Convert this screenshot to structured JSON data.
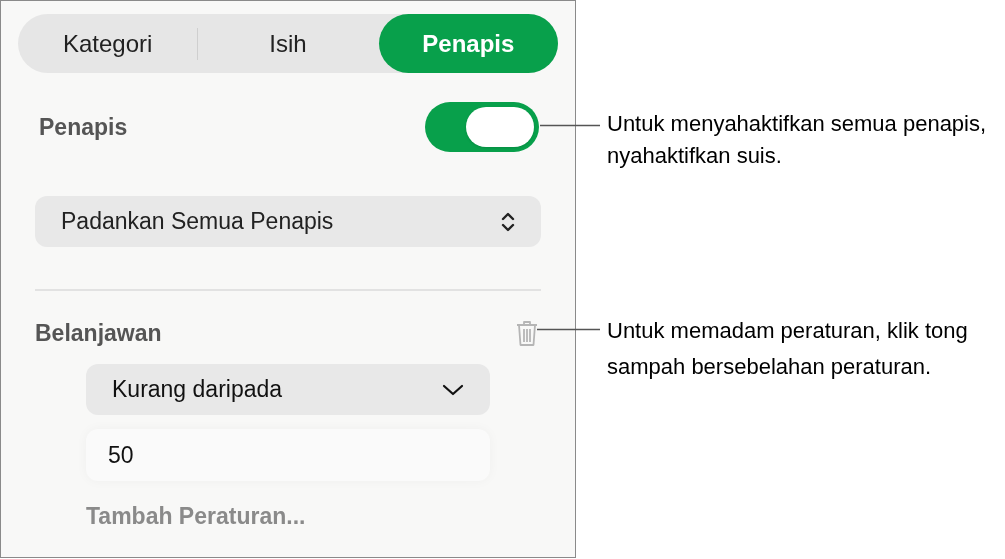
{
  "tabs": [
    {
      "label": "Kategori",
      "selected": false
    },
    {
      "label": "Isih",
      "selected": false
    },
    {
      "label": "Penapis",
      "selected": true
    }
  ],
  "filter_switch": {
    "label": "Penapis",
    "on": true
  },
  "match_popup": {
    "value": "Padankan Semua Penapis"
  },
  "rule": {
    "title": "Belanjawan",
    "condition": "Kurang daripada",
    "value": "50",
    "add_rule": "Tambah Peraturan..."
  },
  "callouts": [
    {
      "text": "Untuk menyahaktifkan semua penapis, nyahaktifkan suis."
    },
    {
      "text": "Untuk memadam peraturan, klik tong sampah bersebelahan peraturan."
    }
  ]
}
